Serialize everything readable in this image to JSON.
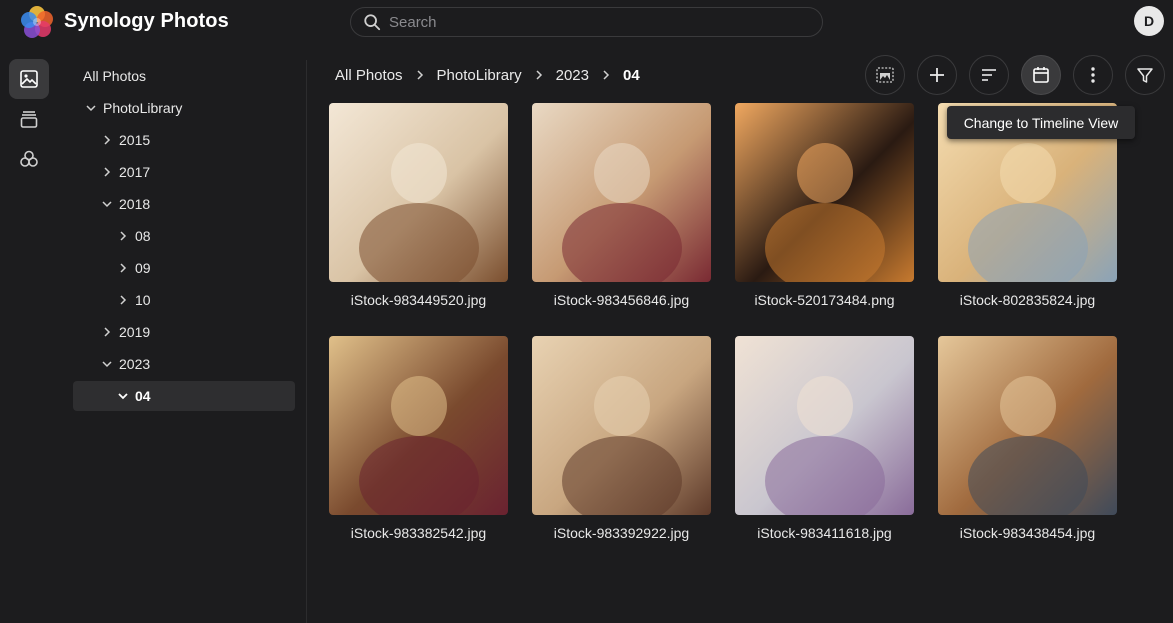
{
  "app": {
    "title": "Synology Photos"
  },
  "search": {
    "placeholder": "Search",
    "value": ""
  },
  "user": {
    "avatar_initial": "D"
  },
  "rail": {
    "items": [
      {
        "icon": "photos-icon",
        "active": true
      },
      {
        "icon": "albums-icon",
        "active": false
      },
      {
        "icon": "shared-space-icon",
        "active": false
      }
    ]
  },
  "tree": {
    "items": [
      {
        "label": "All Photos"
      },
      {
        "label": "PhotoLibrary",
        "expanded": true
      },
      {
        "label": "2015",
        "expanded": false
      },
      {
        "label": "2017",
        "expanded": false
      },
      {
        "label": "2018",
        "expanded": true
      },
      {
        "label": "08",
        "expanded": false
      },
      {
        "label": "09",
        "expanded": false
      },
      {
        "label": "10",
        "expanded": false
      },
      {
        "label": "2019",
        "expanded": false
      },
      {
        "label": "2023",
        "expanded": true
      },
      {
        "label": "04",
        "expanded": true,
        "selected": true
      }
    ]
  },
  "breadcrumb": [
    "All Photos",
    "PhotoLibrary",
    "2023",
    "04"
  ],
  "toolbar": {
    "buttons": [
      "select-icon",
      "add-icon",
      "sort-icon",
      "calendar-icon",
      "more-icon",
      "filter-icon"
    ],
    "active": "calendar-icon",
    "tooltip": "Change to Timeline View"
  },
  "photos": [
    {
      "filename": "iStock-983449520.jpg",
      "palette": [
        "#d9c3a5",
        "#7b4f2f",
        "#f3e7d6"
      ]
    },
    {
      "filename": "iStock-983456846.jpg",
      "palette": [
        "#c69a73",
        "#7a2a33",
        "#e9d9c4"
      ]
    },
    {
      "filename": "iStock-520173484.png",
      "palette": [
        "#2a1a12",
        "#c77a2f",
        "#f0a860"
      ]
    },
    {
      "filename": "iStock-802835824.jpg",
      "palette": [
        "#d9b27a",
        "#8aa3b8",
        "#f4dcb0"
      ]
    },
    {
      "filename": "iStock-983382542.jpg",
      "palette": [
        "#7a4a2e",
        "#6a2230",
        "#e0c08a"
      ]
    },
    {
      "filename": "iStock-983392922.jpg",
      "palette": [
        "#c8a680",
        "#5e3a2a",
        "#e8d2b2"
      ]
    },
    {
      "filename": "iStock-983411618.jpg",
      "palette": [
        "#c9c6cf",
        "#8a6c9a",
        "#f0e2d4"
      ]
    },
    {
      "filename": "iStock-983438454.jpg",
      "palette": [
        "#a06a3e",
        "#3f4a5a",
        "#e5c79a"
      ]
    }
  ],
  "colors": {
    "background": "#1c1c1e",
    "panel": "#2e2e30",
    "accent_text": "#ffffff"
  }
}
